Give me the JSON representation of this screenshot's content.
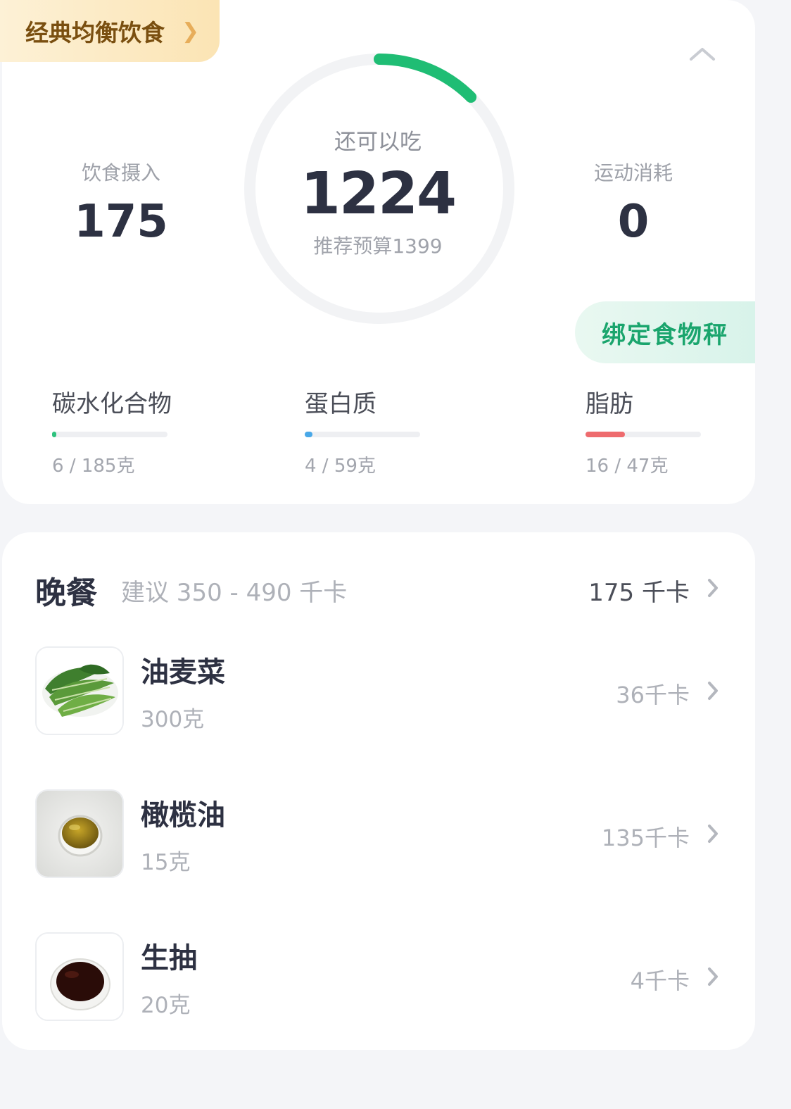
{
  "plan": {
    "label": "经典均衡饮食"
  },
  "budget": {
    "remaining_label": "还可以吃",
    "remaining_value": "1224",
    "recommended_text": "推荐预算1399",
    "progress": 0.125
  },
  "intake": {
    "label": "饮食摄入",
    "value": "175"
  },
  "exercise": {
    "label": "运动消耗",
    "value": "0"
  },
  "scale_button": "绑定食物秤",
  "macros": [
    {
      "name": "碳水化合物",
      "amount": "6 / 185克",
      "fraction": 0.032,
      "color": "#2ec27e"
    },
    {
      "name": "蛋白质",
      "amount": "4 / 59克",
      "fraction": 0.068,
      "color": "#49a8e8"
    },
    {
      "name": "脂肪",
      "amount": "16 / 47克",
      "fraction": 0.34,
      "color": "#ee6b6e"
    }
  ],
  "meal": {
    "title": "晚餐",
    "suggestion": "建议 350 - 490 千卡",
    "total": "175 千卡",
    "items": [
      {
        "name": "油麦菜",
        "quantity": "300克",
        "calories": "36千卡",
        "image": "lettuce-photo"
      },
      {
        "name": "橄榄油",
        "quantity": "15克",
        "calories": "135千卡",
        "image": "olive-oil-photo"
      },
      {
        "name": "生抽",
        "quantity": "20克",
        "calories": "4千卡",
        "image": "soy-sauce-photo"
      }
    ]
  },
  "colors": {
    "accent": "#1fbd74",
    "text": "#2d3142",
    "muted": "#aeb1b8"
  }
}
